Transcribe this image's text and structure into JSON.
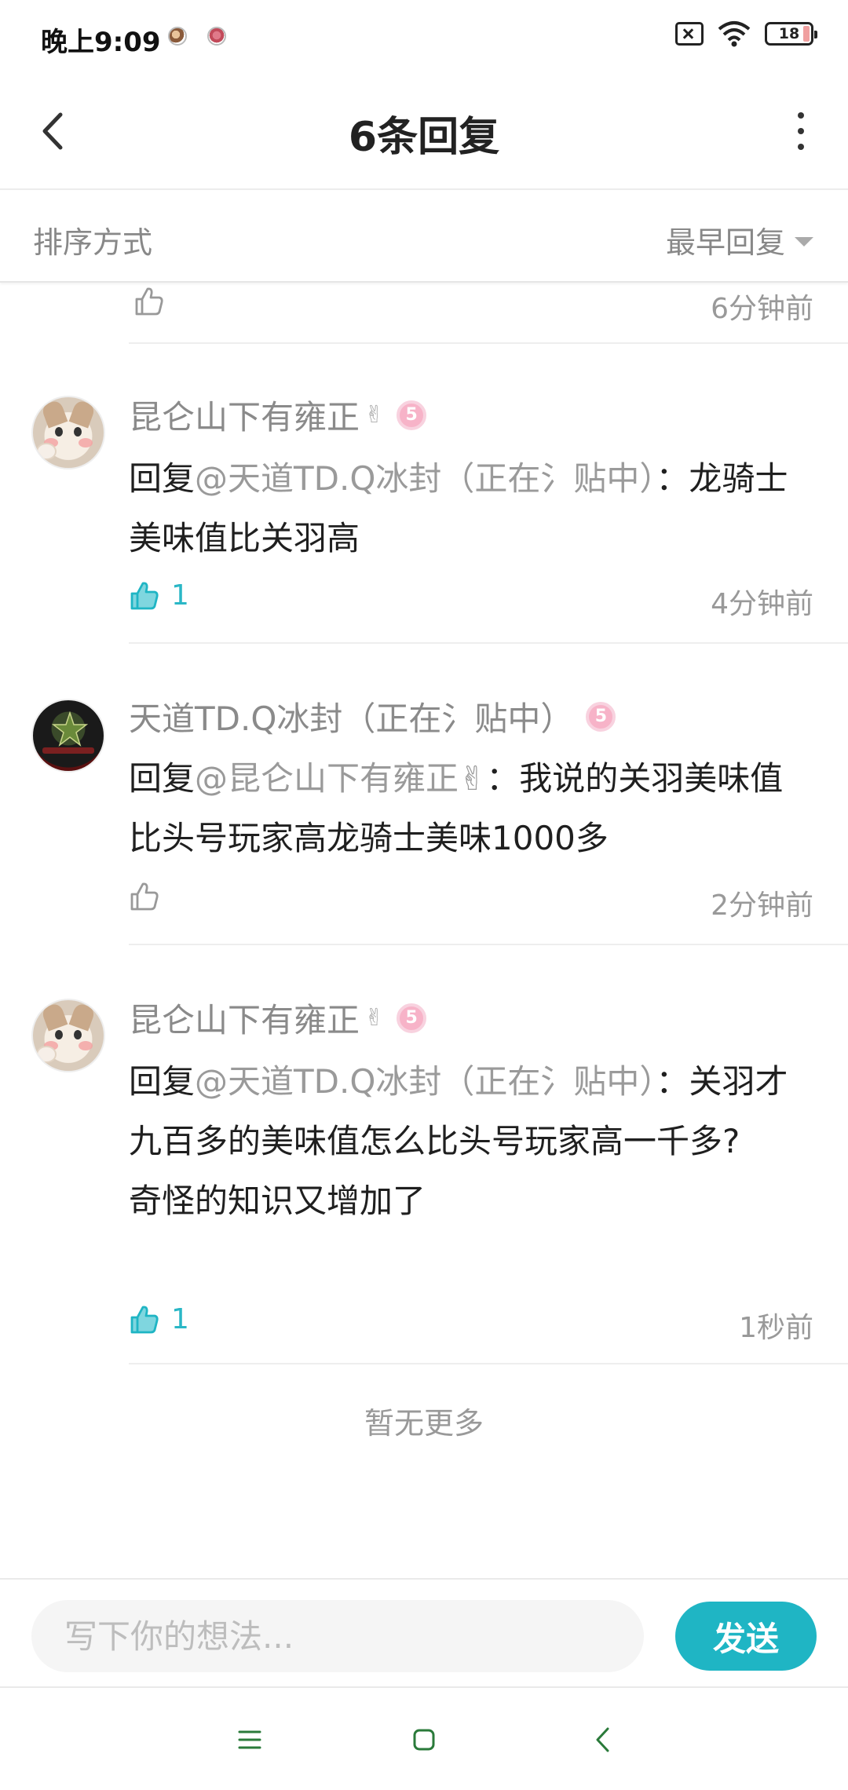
{
  "status_bar": {
    "time": "晚上9:09",
    "battery": "18"
  },
  "header": {
    "title": "6条回复"
  },
  "sort": {
    "label": "排序方式",
    "selected": "最早回复"
  },
  "partial_row": {
    "time": "6分钟前"
  },
  "comments": [
    {
      "author": "昆仑山下有雍正",
      "author_suffix": "✌",
      "level": "5",
      "reply_prefix": "回复",
      "reply_to": "@天道TD.Q冰封（正在氵贴中）",
      "text_line1": "：龙",
      "text_rest": "骑士美味值比关羽高",
      "likes": "1",
      "liked": true,
      "time": "4分钟前"
    },
    {
      "author": "天道TD.Q冰封（正在氵贴中）",
      "author_suffix": "",
      "level": "5",
      "reply_prefix": "回复",
      "reply_to": "@昆仑山下有雍正✌",
      "text_line1": "：我说的关羽美",
      "text_rest": "味值比头号玩家高龙骑士美味1000多",
      "likes": "",
      "liked": false,
      "time": "2分钟前"
    },
    {
      "author": "昆仑山下有雍正",
      "author_suffix": "✌",
      "level": "5",
      "reply_prefix": "回复",
      "reply_to": "@天道TD.Q冰封（正在氵贴中）",
      "text_line1": "：关",
      "text_rest": "羽才九百多的美味值怎么比头号玩家高一千多?",
      "text_extra": "奇怪的知识又增加了",
      "likes": "1",
      "liked": true,
      "time": "1秒前"
    }
  ],
  "no_more": "暂无更多",
  "input": {
    "placeholder": "写下你的想法...",
    "send_label": "发送"
  },
  "colors": {
    "accent": "#1fb5c4",
    "level_badge": "#f7b3c8"
  },
  "icons": [
    "back-arrow-icon",
    "more-vertical-icon",
    "thumbs-up-icon",
    "wifi-icon",
    "sim-off-icon",
    "battery-icon",
    "menu-icon",
    "home-icon",
    "nav-back-icon"
  ]
}
